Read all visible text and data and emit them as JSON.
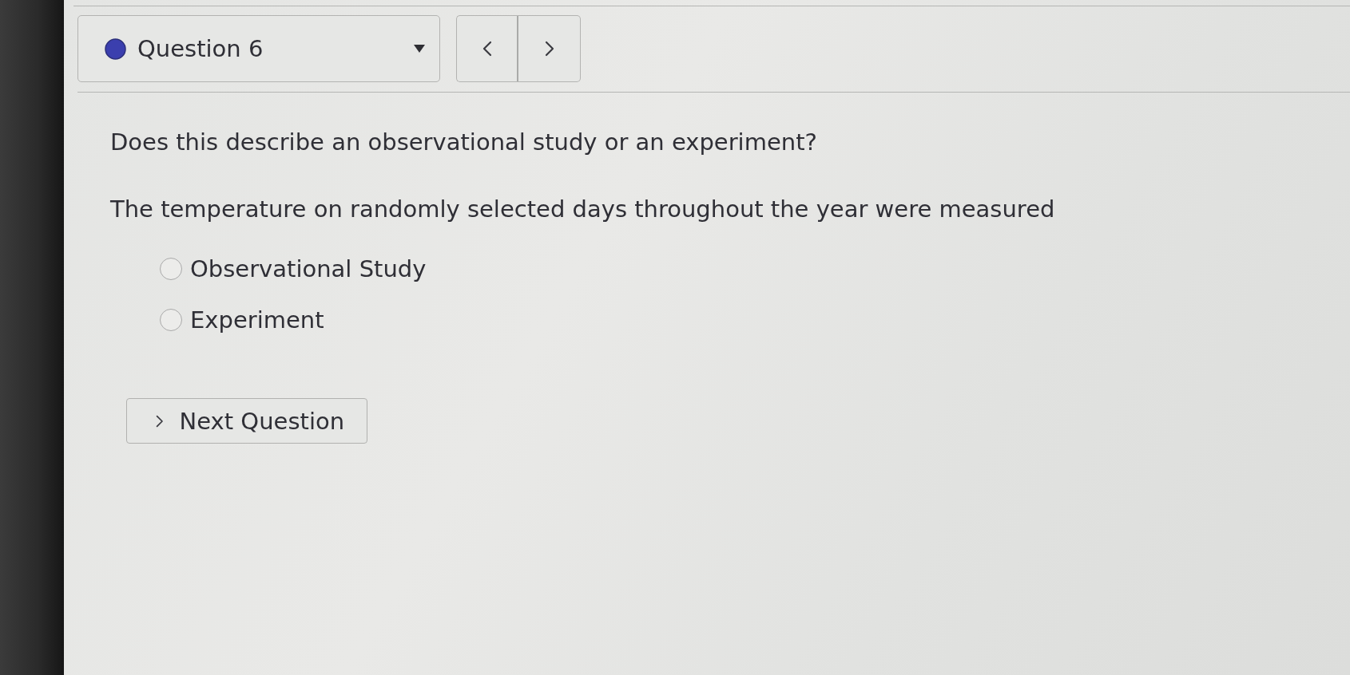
{
  "question_selector": {
    "label": "Question 6"
  },
  "prompt": "Does this describe an observational study or an experiment?",
  "statement": "The temperature on randomly selected days throughout the year were measured",
  "options": [
    {
      "label": "Observational Study",
      "selected": false
    },
    {
      "label": "Experiment",
      "selected": false
    }
  ],
  "next_button": {
    "label": "Next Question"
  }
}
